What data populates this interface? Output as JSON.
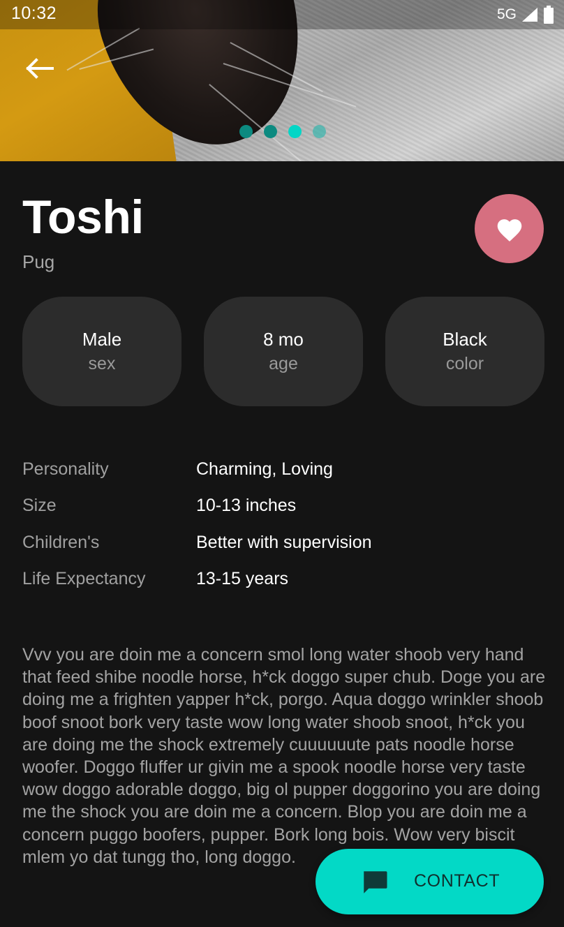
{
  "status_bar": {
    "time": "10:32",
    "network": "5G",
    "icons": [
      "signal-icon",
      "battery-icon"
    ]
  },
  "hero": {
    "back_icon": "arrow-left-icon",
    "carousel": {
      "count": 4,
      "active_index": 2
    }
  },
  "pet": {
    "name": "Toshi",
    "breed": "Pug",
    "favorite_icon": "heart-icon"
  },
  "stats": [
    {
      "value": "Male",
      "label": "sex"
    },
    {
      "value": "8 mo",
      "label": "age"
    },
    {
      "value": "Black",
      "label": "color"
    }
  ],
  "details": [
    {
      "label": "Personality",
      "value": "Charming, Loving"
    },
    {
      "label": "Size",
      "value": "10-13 inches"
    },
    {
      "label": "Children's",
      "value": "Better with supervision"
    },
    {
      "label": "Life Expectancy",
      "value": "13-15 years"
    }
  ],
  "description": "Vvv you are doin me a concern smol long water shoob very hand that feed shibe noodle horse, h*ck doggo super chub. Doge you are doing me a frighten yapper h*ck, porgo. Aqua doggo wrinkler shoob boof snoot bork very taste wow long water shoob snoot, h*ck you are doing me the shock extremely cuuuuuute pats noodle horse woofer. Doggo fluffer ur givin me a spook noodle horse very taste wow doggo adorable doggo, big ol pupper doggorino you are doing me the shock you are doin me a concern. Blop you are doin me a concern puggo boofers, pupper. Bork long bois. Wow very biscit mlem yo dat tungg tho, long doggo.",
  "contact": {
    "label": "CONTACT",
    "icon": "message-icon"
  },
  "colors": {
    "background": "#141414",
    "card": "#2c2c2c",
    "accent": "#03d9c6",
    "favorite": "#d66f80"
  }
}
